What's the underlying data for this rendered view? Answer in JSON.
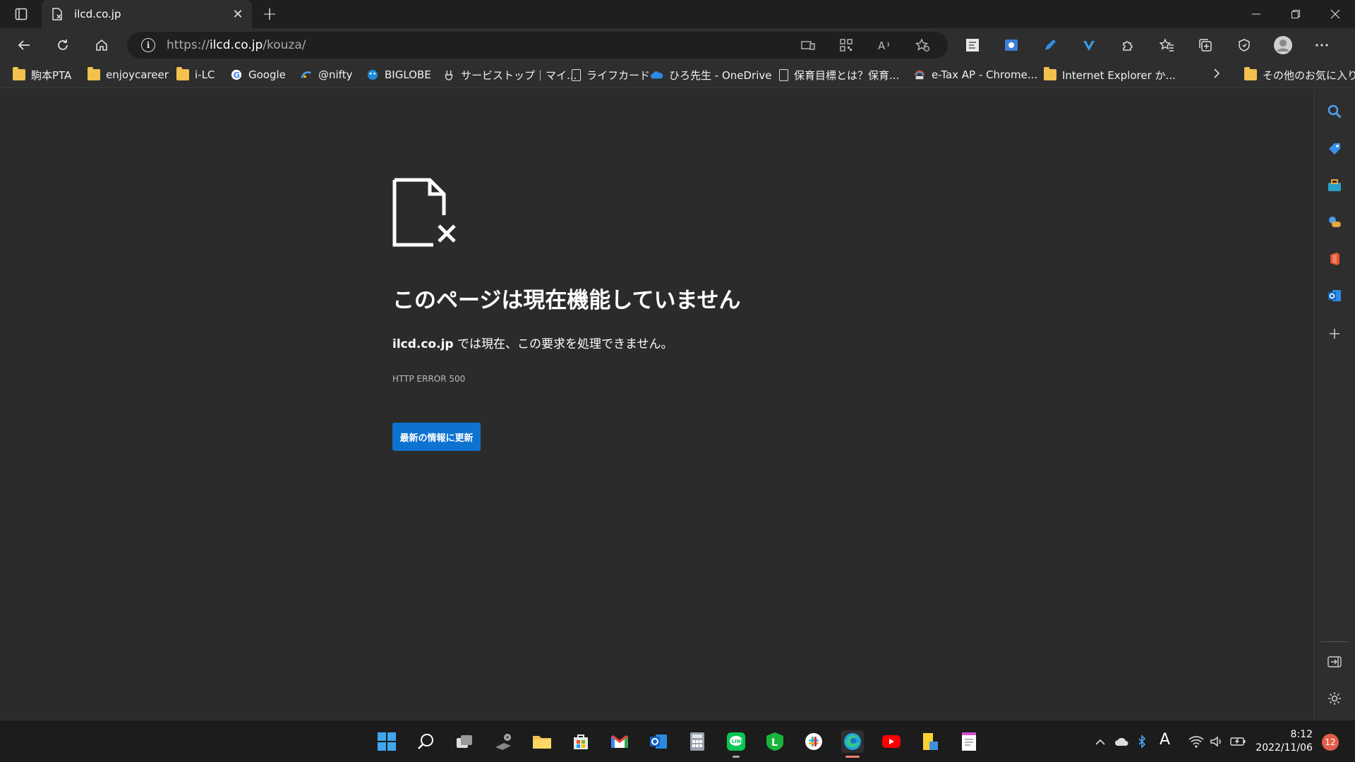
{
  "tab": {
    "title": "ilcd.co.jp",
    "close": "✕"
  },
  "address": {
    "scheme": "https://",
    "host": "ilcd.co.jp",
    "path": "/kouza/"
  },
  "bookmarks": [
    {
      "label": "駒本PTA",
      "icon": "folder"
    },
    {
      "label": "enjoycareer",
      "icon": "folder"
    },
    {
      "label": "i-LC",
      "icon": "folder"
    },
    {
      "label": "Google",
      "icon": "google"
    },
    {
      "label": "@nifty",
      "icon": "nifty"
    },
    {
      "label": "BIGLOBE",
      "icon": "biglobe"
    },
    {
      "label": "サービストップ｜マイ...",
      "icon": "service"
    },
    {
      "label": "ライフカード",
      "icon": "doc"
    },
    {
      "label": "ひろ先生 - OneDrive",
      "icon": "onedrive"
    },
    {
      "label": "保育目標とは？保育...",
      "icon": "doc"
    },
    {
      "label": "e-Tax AP - Chrome...",
      "icon": "etax"
    },
    {
      "label": "Internet Explorer か...",
      "icon": "folder"
    }
  ],
  "other_favorites": "その他のお気に入り",
  "error": {
    "title": "このページは現在機能していません",
    "host": "ilcd.co.jp",
    "message": " では現在、この要求を処理できません。",
    "code": "HTTP ERROR 500",
    "button": "最新の情報に更新"
  },
  "clock": {
    "time": "8:12",
    "date": "2022/11/06"
  },
  "notifications": "12",
  "ime": "A",
  "colors": {
    "accent": "#0e72d0",
    "page_bg": "#2b2b2b",
    "chrome_bg": "#2e2e2e",
    "taskbar_bg": "#1c1c1c"
  }
}
